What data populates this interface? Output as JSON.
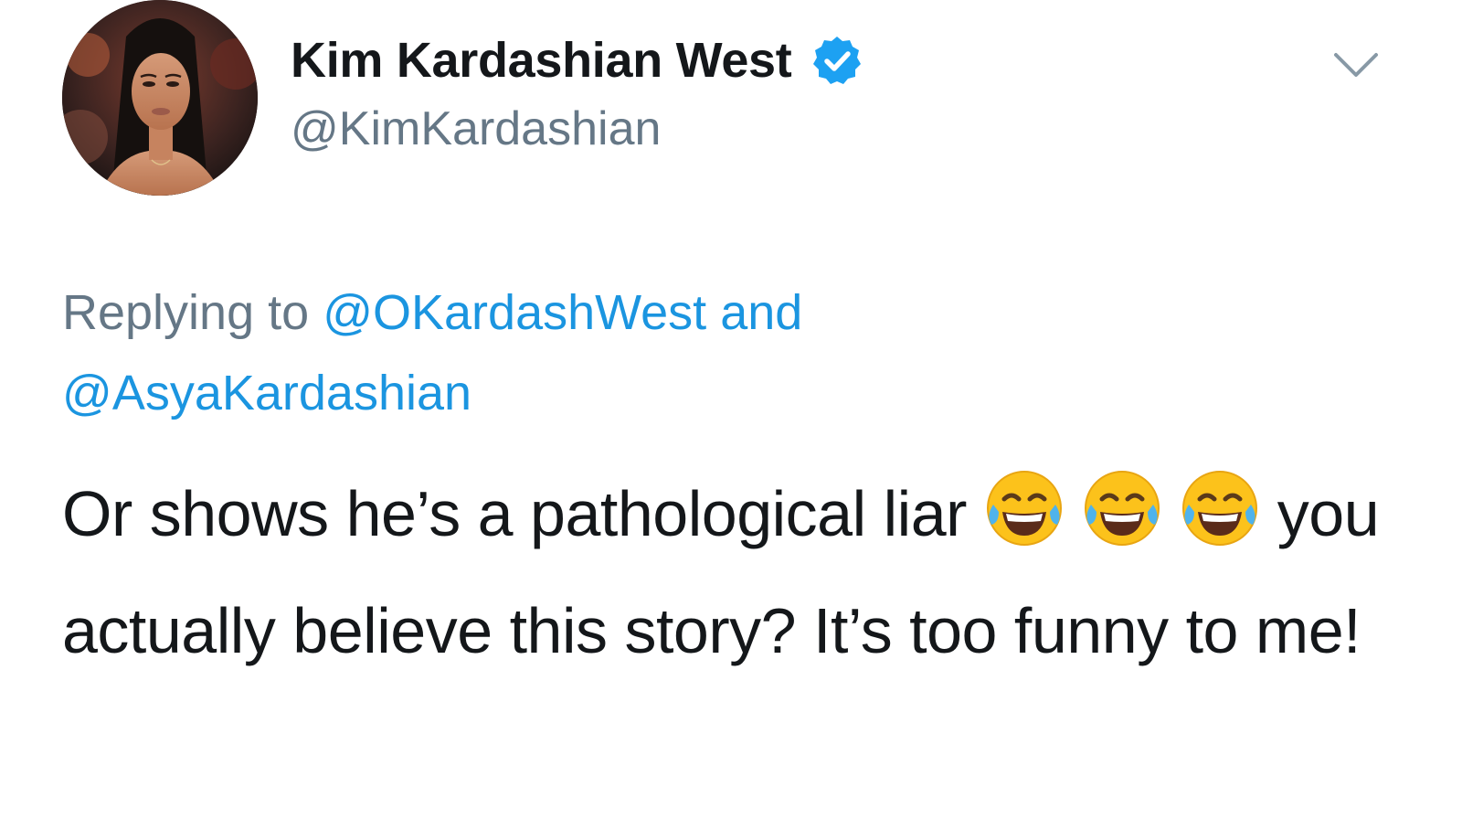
{
  "author": {
    "display_name": "Kim Kardashian West",
    "handle": "@KimKardashian",
    "verified": true,
    "avatar_icon": "profile-photo"
  },
  "menu": {
    "icon": "chevron-down-icon"
  },
  "reply": {
    "prefix": "Replying to",
    "mentions": [
      "@OKardashWest",
      "@AsyaKardashian"
    ],
    "conjunction": "and"
  },
  "tweet": {
    "segments": [
      "Or shows he’s a pathological liar",
      "you actually believe this story? It’s too funny to me!"
    ],
    "emoji": "face-with-tears-of-joy"
  },
  "colors": {
    "link": "#1b95e0",
    "secondary": "#657786",
    "text": "#14171a",
    "verified_badge": "#1da1f2"
  }
}
